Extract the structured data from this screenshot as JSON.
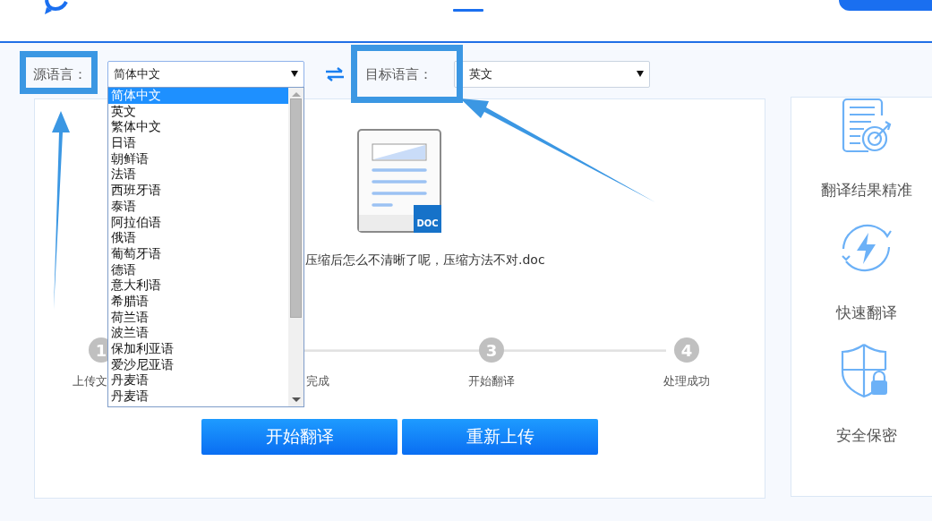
{
  "source_language": {
    "label": "源语言：",
    "value": "简体中文",
    "open": true,
    "options": [
      {
        "label": "简体中文",
        "selected": true
      },
      {
        "label": "英文",
        "selected": false
      },
      {
        "label": "繁体中文",
        "selected": false
      },
      {
        "label": "日语",
        "selected": false
      },
      {
        "label": "朝鲜语",
        "selected": false
      },
      {
        "label": "法语",
        "selected": false
      },
      {
        "label": "西班牙语",
        "selected": false
      },
      {
        "label": "泰语",
        "selected": false
      },
      {
        "label": "阿拉伯语",
        "selected": false
      },
      {
        "label": "俄语",
        "selected": false
      },
      {
        "label": "葡萄牙语",
        "selected": false
      },
      {
        "label": "德语",
        "selected": false
      },
      {
        "label": "意大利语",
        "selected": false
      },
      {
        "label": "希腊语",
        "selected": false
      },
      {
        "label": "荷兰语",
        "selected": false
      },
      {
        "label": "波兰语",
        "selected": false
      },
      {
        "label": "保加利亚语",
        "selected": false
      },
      {
        "label": "爱沙尼亚语",
        "selected": false
      },
      {
        "label": "丹麦语",
        "selected": false
      },
      {
        "label": "丹麦语",
        "selected": false
      }
    ]
  },
  "target_language": {
    "label": "目标语言：",
    "value": "英文"
  },
  "file": {
    "name": "压缩后怎么不清晰了呢，压缩方法不对.doc",
    "badge": "DOC"
  },
  "steps": [
    {
      "number": "1",
      "label": "上传文"
    },
    {
      "label": "完成"
    },
    {
      "number": "3",
      "label": "开始翻译"
    },
    {
      "number": "4",
      "label": "处理成功"
    }
  ],
  "buttons": [
    "开始翻译",
    "重新上传"
  ],
  "features": [
    {
      "kind": "accuracy",
      "label": "翻译结果精准"
    },
    {
      "kind": "speed",
      "label": "快速翻译"
    },
    {
      "kind": "security",
      "label": "安全保密"
    }
  ]
}
